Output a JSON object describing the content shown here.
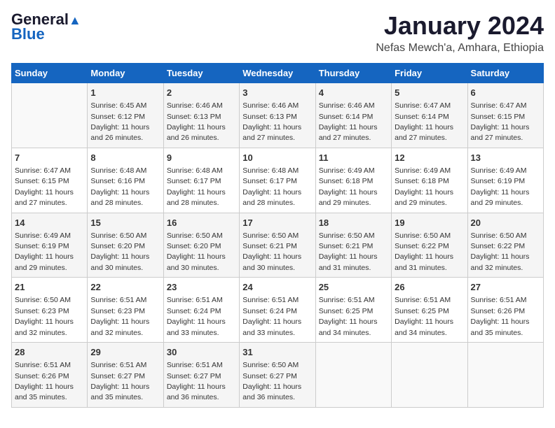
{
  "header": {
    "logo_general": "General",
    "logo_blue": "Blue",
    "title": "January 2024",
    "subtitle": "Nefas Mewch'a, Amhara, Ethiopia"
  },
  "weekdays": [
    "Sunday",
    "Monday",
    "Tuesday",
    "Wednesday",
    "Thursday",
    "Friday",
    "Saturday"
  ],
  "weeks": [
    [
      {
        "day": "",
        "sunrise": "",
        "sunset": "",
        "daylight": ""
      },
      {
        "day": "1",
        "sunrise": "Sunrise: 6:45 AM",
        "sunset": "Sunset: 6:12 PM",
        "daylight": "Daylight: 11 hours and 26 minutes."
      },
      {
        "day": "2",
        "sunrise": "Sunrise: 6:46 AM",
        "sunset": "Sunset: 6:13 PM",
        "daylight": "Daylight: 11 hours and 26 minutes."
      },
      {
        "day": "3",
        "sunrise": "Sunrise: 6:46 AM",
        "sunset": "Sunset: 6:13 PM",
        "daylight": "Daylight: 11 hours and 27 minutes."
      },
      {
        "day": "4",
        "sunrise": "Sunrise: 6:46 AM",
        "sunset": "Sunset: 6:14 PM",
        "daylight": "Daylight: 11 hours and 27 minutes."
      },
      {
        "day": "5",
        "sunrise": "Sunrise: 6:47 AM",
        "sunset": "Sunset: 6:14 PM",
        "daylight": "Daylight: 11 hours and 27 minutes."
      },
      {
        "day": "6",
        "sunrise": "Sunrise: 6:47 AM",
        "sunset": "Sunset: 6:15 PM",
        "daylight": "Daylight: 11 hours and 27 minutes."
      }
    ],
    [
      {
        "day": "7",
        "sunrise": "Sunrise: 6:47 AM",
        "sunset": "Sunset: 6:15 PM",
        "daylight": "Daylight: 11 hours and 27 minutes."
      },
      {
        "day": "8",
        "sunrise": "Sunrise: 6:48 AM",
        "sunset": "Sunset: 6:16 PM",
        "daylight": "Daylight: 11 hours and 28 minutes."
      },
      {
        "day": "9",
        "sunrise": "Sunrise: 6:48 AM",
        "sunset": "Sunset: 6:17 PM",
        "daylight": "Daylight: 11 hours and 28 minutes."
      },
      {
        "day": "10",
        "sunrise": "Sunrise: 6:48 AM",
        "sunset": "Sunset: 6:17 PM",
        "daylight": "Daylight: 11 hours and 28 minutes."
      },
      {
        "day": "11",
        "sunrise": "Sunrise: 6:49 AM",
        "sunset": "Sunset: 6:18 PM",
        "daylight": "Daylight: 11 hours and 29 minutes."
      },
      {
        "day": "12",
        "sunrise": "Sunrise: 6:49 AM",
        "sunset": "Sunset: 6:18 PM",
        "daylight": "Daylight: 11 hours and 29 minutes."
      },
      {
        "day": "13",
        "sunrise": "Sunrise: 6:49 AM",
        "sunset": "Sunset: 6:19 PM",
        "daylight": "Daylight: 11 hours and 29 minutes."
      }
    ],
    [
      {
        "day": "14",
        "sunrise": "Sunrise: 6:49 AM",
        "sunset": "Sunset: 6:19 PM",
        "daylight": "Daylight: 11 hours and 29 minutes."
      },
      {
        "day": "15",
        "sunrise": "Sunrise: 6:50 AM",
        "sunset": "Sunset: 6:20 PM",
        "daylight": "Daylight: 11 hours and 30 minutes."
      },
      {
        "day": "16",
        "sunrise": "Sunrise: 6:50 AM",
        "sunset": "Sunset: 6:20 PM",
        "daylight": "Daylight: 11 hours and 30 minutes."
      },
      {
        "day": "17",
        "sunrise": "Sunrise: 6:50 AM",
        "sunset": "Sunset: 6:21 PM",
        "daylight": "Daylight: 11 hours and 30 minutes."
      },
      {
        "day": "18",
        "sunrise": "Sunrise: 6:50 AM",
        "sunset": "Sunset: 6:21 PM",
        "daylight": "Daylight: 11 hours and 31 minutes."
      },
      {
        "day": "19",
        "sunrise": "Sunrise: 6:50 AM",
        "sunset": "Sunset: 6:22 PM",
        "daylight": "Daylight: 11 hours and 31 minutes."
      },
      {
        "day": "20",
        "sunrise": "Sunrise: 6:50 AM",
        "sunset": "Sunset: 6:22 PM",
        "daylight": "Daylight: 11 hours and 32 minutes."
      }
    ],
    [
      {
        "day": "21",
        "sunrise": "Sunrise: 6:50 AM",
        "sunset": "Sunset: 6:23 PM",
        "daylight": "Daylight: 11 hours and 32 minutes."
      },
      {
        "day": "22",
        "sunrise": "Sunrise: 6:51 AM",
        "sunset": "Sunset: 6:23 PM",
        "daylight": "Daylight: 11 hours and 32 minutes."
      },
      {
        "day": "23",
        "sunrise": "Sunrise: 6:51 AM",
        "sunset": "Sunset: 6:24 PM",
        "daylight": "Daylight: 11 hours and 33 minutes."
      },
      {
        "day": "24",
        "sunrise": "Sunrise: 6:51 AM",
        "sunset": "Sunset: 6:24 PM",
        "daylight": "Daylight: 11 hours and 33 minutes."
      },
      {
        "day": "25",
        "sunrise": "Sunrise: 6:51 AM",
        "sunset": "Sunset: 6:25 PM",
        "daylight": "Daylight: 11 hours and 34 minutes."
      },
      {
        "day": "26",
        "sunrise": "Sunrise: 6:51 AM",
        "sunset": "Sunset: 6:25 PM",
        "daylight": "Daylight: 11 hours and 34 minutes."
      },
      {
        "day": "27",
        "sunrise": "Sunrise: 6:51 AM",
        "sunset": "Sunset: 6:26 PM",
        "daylight": "Daylight: 11 hours and 35 minutes."
      }
    ],
    [
      {
        "day": "28",
        "sunrise": "Sunrise: 6:51 AM",
        "sunset": "Sunset: 6:26 PM",
        "daylight": "Daylight: 11 hours and 35 minutes."
      },
      {
        "day": "29",
        "sunrise": "Sunrise: 6:51 AM",
        "sunset": "Sunset: 6:27 PM",
        "daylight": "Daylight: 11 hours and 35 minutes."
      },
      {
        "day": "30",
        "sunrise": "Sunrise: 6:51 AM",
        "sunset": "Sunset: 6:27 PM",
        "daylight": "Daylight: 11 hours and 36 minutes."
      },
      {
        "day": "31",
        "sunrise": "Sunrise: 6:50 AM",
        "sunset": "Sunset: 6:27 PM",
        "daylight": "Daylight: 11 hours and 36 minutes."
      },
      {
        "day": "",
        "sunrise": "",
        "sunset": "",
        "daylight": ""
      },
      {
        "day": "",
        "sunrise": "",
        "sunset": "",
        "daylight": ""
      },
      {
        "day": "",
        "sunrise": "",
        "sunset": "",
        "daylight": ""
      }
    ]
  ]
}
